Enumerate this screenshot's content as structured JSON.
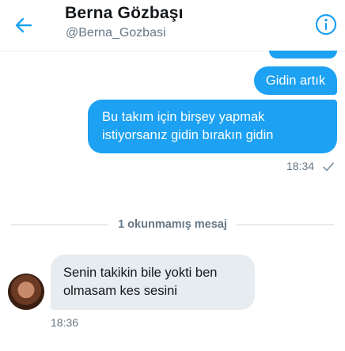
{
  "header": {
    "name": "Berna Gözbaşı",
    "handle": "@Berna_Gozbasi"
  },
  "messages": {
    "sent": [
      {
        "lines": [
          "Gidin artık"
        ]
      },
      {
        "lines": [
          "Bu takım için birşey yapmak",
          "istiyorsanız gidin bırakın gidin"
        ]
      }
    ],
    "sent_time": "18:34",
    "unread_divider": "1 okunmamış mesaj",
    "received": {
      "lines": [
        "Senin takikin bile yokti ben",
        "olmasam kes sesini"
      ],
      "time": "18:36"
    }
  },
  "colors": {
    "accent": "#1da1f2",
    "incoming_bubble": "#e6ecf0",
    "secondary_text": "#657786"
  },
  "icons": {
    "back": "back-arrow-icon",
    "info": "info-icon",
    "read": "check-icon"
  }
}
